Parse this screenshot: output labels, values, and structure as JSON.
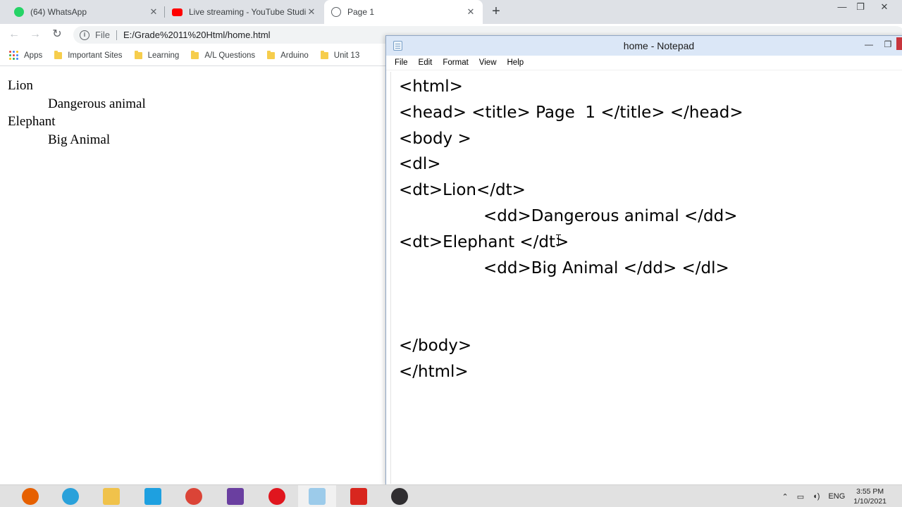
{
  "browser": {
    "tabs": [
      {
        "title": "(64) WhatsApp",
        "icon": "whatsapp-icon",
        "color": "#25d366"
      },
      {
        "title": "Live streaming - YouTube Studio",
        "icon": "youtube-icon",
        "color": "#ff0000"
      },
      {
        "title": "Page 1",
        "icon": "globe-icon",
        "color": "#5f6368"
      }
    ],
    "address": {
      "scheme_chip": "File",
      "url": "E:/Grade%2011%20Html/home.html"
    },
    "bookmarks": [
      "Apps",
      "Important Sites",
      "Learning",
      "A/L Questions",
      "Arduino",
      "Unit 13"
    ],
    "page": {
      "terms": [
        {
          "term": "Lion",
          "definition": "Dangerous animal"
        },
        {
          "term": "Elephant",
          "definition": "Big Animal"
        }
      ]
    }
  },
  "notepad": {
    "title": "home - Notepad",
    "menus": [
      "File",
      "Edit",
      "Format",
      "View",
      "Help"
    ],
    "lines": [
      {
        "text": "<html>",
        "indent": false
      },
      {
        "text": "<head> <title> Page  1 </title> </head>",
        "indent": false
      },
      {
        "text": "<body >",
        "indent": false
      },
      {
        "text": "<dl>",
        "indent": false
      },
      {
        "text": "<dt>Lion</dt>",
        "indent": false
      },
      {
        "text": "<dd>Dangerous animal </dd>",
        "indent": true
      },
      {
        "text": "<dt>Elephant </dt>",
        "indent": false
      },
      {
        "text": "<dd>Big Animal </dd> </dl>",
        "indent": true
      },
      {
        "text": "",
        "indent": false
      },
      {
        "text": "",
        "indent": false
      },
      {
        "text": "</body>",
        "indent": false
      },
      {
        "text": "</html>",
        "indent": false
      }
    ]
  },
  "taskbar": {
    "apps": [
      {
        "name": "firefox-icon",
        "color": "#e66000"
      },
      {
        "name": "telegram-icon",
        "color": "#2aa1da"
      },
      {
        "name": "file-explorer-icon",
        "color": "#f0c24b"
      },
      {
        "name": "internet-explorer-icon",
        "color": "#1ea0e0"
      },
      {
        "name": "chrome-icon",
        "color": "#db4437"
      },
      {
        "name": "winrar-icon",
        "color": "#6a3fa0"
      },
      {
        "name": "opera-icon",
        "color": "#e0161e"
      },
      {
        "name": "notepad-icon",
        "color": "#9ccbea"
      },
      {
        "name": "acrobat-icon",
        "color": "#d8261e"
      },
      {
        "name": "obs-icon",
        "color": "#302e31"
      }
    ],
    "language": "ENG",
    "time": "3:55 PM",
    "date": "1/10/2021"
  }
}
